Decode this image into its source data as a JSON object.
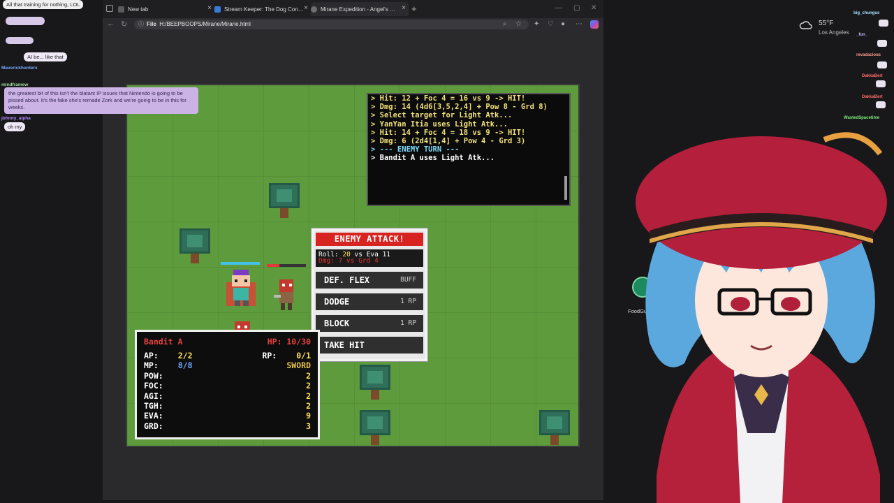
{
  "browser": {
    "tabs": [
      {
        "label": "New tab",
        "color": "#5b5b5b"
      },
      {
        "label": "Stream Keeper: The Dog Control",
        "color": "#3a7bd5"
      },
      {
        "label": "Mirane Expedition - Angel's Swor",
        "color": "#6f6f6f",
        "active": true
      }
    ],
    "url_scheme": "File",
    "url": "H:/BEEPBOOPS/Mirane/Mirane.html"
  },
  "chat": {
    "messages": [
      {
        "text": "All that training for nothing, LOL"
      },
      {
        "user": "Maverickhunterx"
      },
      {
        "user": "mindframew"
      },
      {
        "text": "AI be... like that"
      },
      {
        "text": "the greatest bit of this isn't the blatant IP issues that Nintendo is going to be pissed about. It's the fake she's remade Zork and we're going to be in this for weeks."
      },
      {
        "user": "johnny_alpha"
      },
      {
        "text": "oh my"
      }
    ]
  },
  "combat_log": [
    {
      "text": "> Hit: 12 + Foc 4 = 16 vs 9 -> HIT!",
      "kind": "normal"
    },
    {
      "text": "> Dmg: 14 (4d6[3,5,2,4] + Pow 8 - Grd 8)",
      "kind": "normal"
    },
    {
      "text": "> Select target for Light Atk...",
      "kind": "normal"
    },
    {
      "text": "> YanYan Itia uses Light Atk...",
      "kind": "normal"
    },
    {
      "text": "> Hit: 14 + Foc 4 = 18 vs 9 -> HIT!",
      "kind": "normal"
    },
    {
      "text": "> Dmg: 6 (2d4[1,4] + Pow 4 - Grd 3)",
      "kind": "normal"
    },
    {
      "text": "> --- ENEMY TURN ---",
      "kind": "header"
    },
    {
      "text": "> Bandit A uses Light Atk...",
      "kind": "current"
    }
  ],
  "enemy_attack": {
    "title": "ENEMY ATTACK!",
    "roll_label": "Roll:",
    "roll_value": "20",
    "roll_vs": "vs Eva 11",
    "dmg_line": "Dmg: 7 vs Grd 4",
    "options": [
      {
        "label": "DEF. FLEX",
        "cost": "BUFF"
      },
      {
        "label": "DODGE",
        "cost": "1 RP"
      },
      {
        "label": "BLOCK",
        "cost": "1 RP"
      },
      {
        "label": "TAKE HIT",
        "cost": ""
      }
    ]
  },
  "stats": {
    "name": "Bandit A",
    "hp": "HP: 10/30",
    "ap_label": "AP:",
    "ap": "2/2",
    "rp_label": "RP:",
    "rp": "0/1",
    "mp_label": "MP:",
    "mp": "8/8",
    "weapon": "SWORD",
    "rows": [
      {
        "k": "POW:",
        "v": "2"
      },
      {
        "k": "FOC:",
        "v": "2"
      },
      {
        "k": "AGI:",
        "v": "2"
      },
      {
        "k": "TGH:",
        "v": "2"
      },
      {
        "k": "EVA:",
        "v": "9"
      },
      {
        "k": "GRD:",
        "v": "3"
      }
    ]
  },
  "weather": {
    "temp": "55°F",
    "city": "Los Angeles"
  },
  "desktop": {
    "icon_label": "FoodGuessr"
  },
  "right_chat_users": [
    "big_chungus",
    "_fun_",
    "revadacious",
    "DakkaBert",
    "DakkaBert",
    "WastedSpacetime"
  ],
  "colors": {
    "grass": "#5d9b3c",
    "log_text": "#f3e27a",
    "alert_red": "#d72420"
  }
}
